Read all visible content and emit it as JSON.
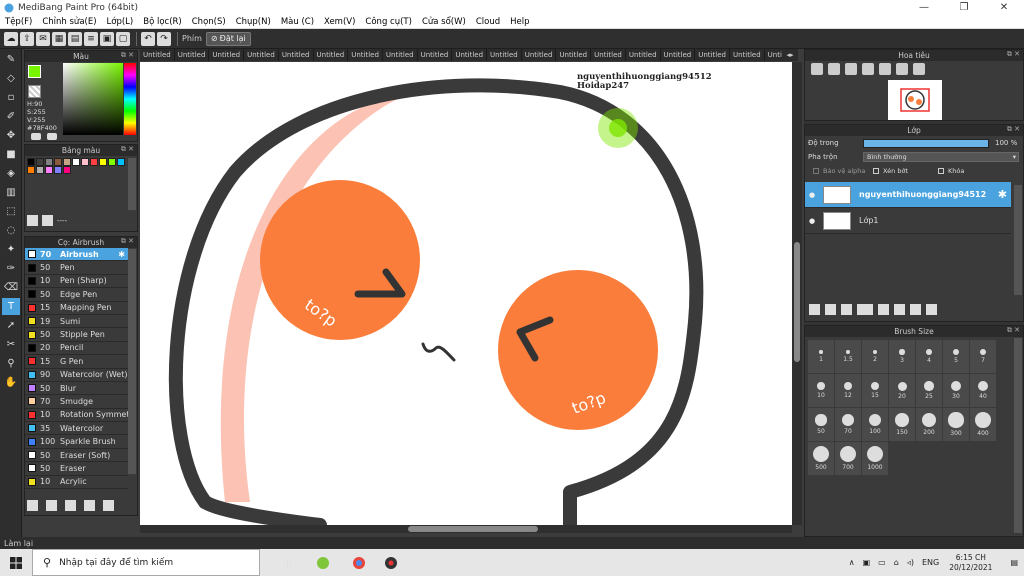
{
  "window": {
    "title": "MediBang Paint Pro (64bit)",
    "controls": [
      "—",
      "❐",
      "✕"
    ]
  },
  "menu": [
    "Tệp(F)",
    "Chỉnh sửa(E)",
    "Lớp(L)",
    "Bộ lọc(R)",
    "Chọn(S)",
    "Chụp(N)",
    "Màu (C)",
    "Xem(V)",
    "Công cụ(T)",
    "Cửa sổ(W)",
    "Cloud",
    "Help"
  ],
  "toolbar": {
    "label": "Phím",
    "reset": "Đặt lại"
  },
  "color_panel": {
    "title": "Màu",
    "h": "H:90",
    "s": "S:255",
    "v": "V:255",
    "hex": "#78F400",
    "fg": "#78F400"
  },
  "palette_panel": {
    "title": "Bảng màu",
    "count": "----",
    "swatches": [
      "#000000",
      "#404040",
      "#808080",
      "#8b5a3c",
      "#c4a484",
      "#ffffff",
      "#ffc0cb",
      "#ff4040",
      "#ffff00",
      "#80ff00",
      "#00c0ff",
      "#ff8000",
      "#b0b0b0",
      "#ff80ff",
      "#8080ff",
      "#ff0080"
    ]
  },
  "brush_panel": {
    "title": "Cọ: Airbrush",
    "brushes": [
      {
        "size": "70",
        "name": "Airbrush",
        "color": "#ffffff"
      },
      {
        "size": "50",
        "name": "Pen",
        "color": "#000000"
      },
      {
        "size": "10",
        "name": "Pen (Sharp)",
        "color": "#000000"
      },
      {
        "size": "50",
        "name": "Edge Pen",
        "color": "#000000"
      },
      {
        "size": "15",
        "name": "Mapping Pen",
        "color": "#ff3030"
      },
      {
        "size": "19",
        "name": "Sumi",
        "color": "#f0e020"
      },
      {
        "size": "50",
        "name": "Stipple Pen",
        "color": "#f0e020"
      },
      {
        "size": "20",
        "name": "Pencil",
        "color": "#000000"
      },
      {
        "size": "15",
        "name": "G Pen",
        "color": "#ff3030"
      },
      {
        "size": "90",
        "name": "Watercolor (Wet)",
        "color": "#40c0f0"
      },
      {
        "size": "50",
        "name": "Blur",
        "color": "#c080ff"
      },
      {
        "size": "70",
        "name": "Smudge",
        "color": "#ffd0a0"
      },
      {
        "size": "10",
        "name": "Rotation Symmetry",
        "color": "#ff3030"
      },
      {
        "size": "35",
        "name": "Watercolor",
        "color": "#40c0f0"
      },
      {
        "size": "100",
        "name": "Sparkle Brush",
        "color": "#4080ff"
      },
      {
        "size": "50",
        "name": "Eraser (Soft)",
        "color": "#ffffff"
      },
      {
        "size": "50",
        "name": "Eraser",
        "color": "#ffffff"
      },
      {
        "size": "10",
        "name": "Acrylic",
        "color": "#f0e020"
      }
    ]
  },
  "tabs": [
    "Untitled",
    "Untitled",
    "Untitled",
    "Untitled",
    "Untitled",
    "Untitled",
    "Untitled",
    "Untitled",
    "Untitled",
    "Untitled",
    "Untitled",
    "Untitled",
    "Untitled",
    "Untitled",
    "Untitled",
    "Untitled",
    "Untitled",
    "Untitled",
    "Untitled",
    "Untitled",
    "Untitled",
    "Untitled",
    "Untitled"
  ],
  "watermark": {
    "line1": "nguyenthihuonggiang94512",
    "line2": "Hoidap247"
  },
  "canvas_text": {
    "blush_left": "to?p",
    "blush_right": "to?p"
  },
  "navigator": {
    "title": "Hoa tiêu"
  },
  "layer_panel": {
    "title": "Lớp",
    "opacity_label": "Độ trong",
    "opacity_value": "100 %",
    "opacity": 100,
    "blend_label": "Pha trộn",
    "blend_value": "Bình thường",
    "protect_alpha": "Bảo vệ alpha",
    "clipping": "Xén bớt",
    "lock": "Khóa",
    "layers": [
      {
        "name": "nguyenthihuonggiang94512",
        "selected": true
      },
      {
        "name": "Lớp1",
        "selected": false
      }
    ]
  },
  "brush_size_panel": {
    "title": "Brush Size",
    "sizes": [
      "1",
      "1.5",
      "2",
      "3",
      "4",
      "5",
      "7",
      "10",
      "12",
      "15",
      "20",
      "25",
      "30",
      "40",
      "50",
      "70",
      "100",
      "150",
      "200",
      "300",
      "400",
      "500",
      "700",
      "1000"
    ]
  },
  "status": "Làm lại",
  "taskbar": {
    "search_placeholder": "Nhập tại đây để tìm kiếm",
    "lang": "ENG",
    "time": "6:15 CH",
    "date": "20/12/2021"
  },
  "colors": {
    "accent": "#4aa3df",
    "face_outline": "#3a3a3a",
    "blush": "#fa7d3b",
    "pink": "#fcc3b4",
    "green_glow": "#7fe600"
  }
}
